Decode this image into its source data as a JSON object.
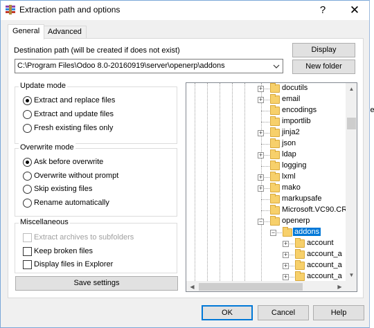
{
  "window": {
    "title": "Extraction path and options",
    "help_glyph": "?",
    "close_glyph": "✕"
  },
  "tabs": [
    {
      "label": "General",
      "active": true
    },
    {
      "label": "Advanced",
      "active": false
    }
  ],
  "destination": {
    "label": "Destination path (will be created if does not exist)",
    "value": "C:\\Program Files\\Odoo 8.0-20160919\\server\\openerp\\addons"
  },
  "buttons": {
    "display": "Display",
    "new_folder": "New folder",
    "save_settings": "Save settings",
    "ok": "OK",
    "cancel": "Cancel",
    "help": "Help"
  },
  "update_mode": {
    "title": "Update mode",
    "options": [
      {
        "label": "Extract and replace files",
        "selected": true
      },
      {
        "label": "Extract and update files",
        "selected": false
      },
      {
        "label": "Fresh existing files only",
        "selected": false
      }
    ]
  },
  "overwrite_mode": {
    "title": "Overwrite mode",
    "options": [
      {
        "label": "Ask before overwrite",
        "selected": true
      },
      {
        "label": "Overwrite without prompt",
        "selected": false
      },
      {
        "label": "Skip existing files",
        "selected": false
      },
      {
        "label": "Rename automatically",
        "selected": false
      }
    ]
  },
  "miscellaneous": {
    "title": "Miscellaneous",
    "options": [
      {
        "label": "Extract archives to subfolders",
        "checked": false,
        "enabled": false
      },
      {
        "label": "Keep broken files",
        "checked": false,
        "enabled": true
      },
      {
        "label": "Display files in Explorer",
        "checked": false,
        "enabled": true
      }
    ]
  },
  "tree": {
    "items": [
      {
        "label": "docutils",
        "expandable": true,
        "level": 1
      },
      {
        "label": "email",
        "expandable": true,
        "level": 1
      },
      {
        "label": "encodings",
        "expandable": false,
        "level": 1
      },
      {
        "label": "importlib",
        "expandable": false,
        "level": 1
      },
      {
        "label": "jinja2",
        "expandable": true,
        "level": 1
      },
      {
        "label": "json",
        "expandable": false,
        "level": 1
      },
      {
        "label": "ldap",
        "expandable": true,
        "level": 1
      },
      {
        "label": "logging",
        "expandable": false,
        "level": 1
      },
      {
        "label": "lxml",
        "expandable": true,
        "level": 1
      },
      {
        "label": "mako",
        "expandable": true,
        "level": 1
      },
      {
        "label": "markupsafe",
        "expandable": false,
        "level": 1
      },
      {
        "label": "Microsoft.VC90.CR",
        "expandable": false,
        "level": 1
      },
      {
        "label": "openerp",
        "expandable": true,
        "expanded": true,
        "level": 1
      },
      {
        "label": "addons",
        "expandable": true,
        "expanded": true,
        "selected": true,
        "level": 2
      },
      {
        "label": "account",
        "expandable": true,
        "level": 3
      },
      {
        "label": "account_a",
        "expandable": true,
        "level": 3
      },
      {
        "label": "account_a",
        "expandable": true,
        "level": 3
      },
      {
        "label": "account_a",
        "expandable": true,
        "level": 3
      }
    ]
  },
  "background": {
    "peek_text": "se"
  },
  "colors": {
    "selection": "#0078d7",
    "folder": "#f7d06b",
    "default_button_border": "#0078d7"
  }
}
